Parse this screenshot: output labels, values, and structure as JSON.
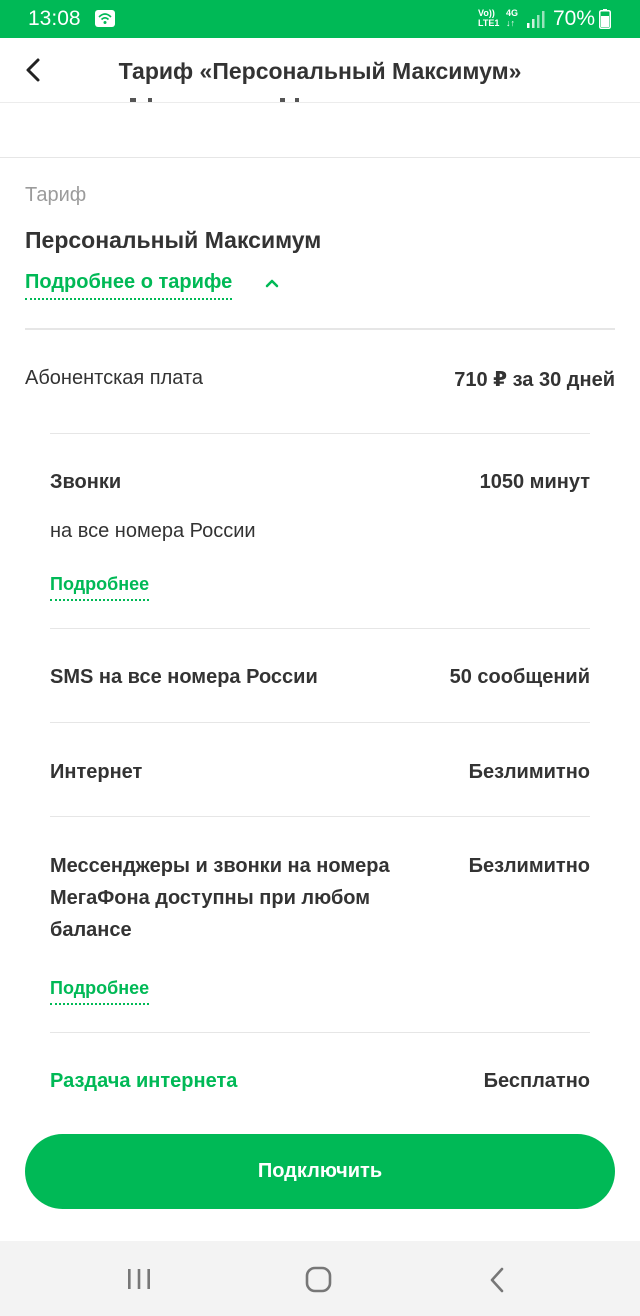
{
  "status_bar": {
    "time": "13:08",
    "network_top": "Vo))",
    "network_bottom": "LTE1",
    "network_type": "4G",
    "battery_percent": "70%"
  },
  "header": {
    "title": "Тариф «Персональный Максимум»"
  },
  "tariff": {
    "caption": "Тариф",
    "name": "Персональный Максимум",
    "details_link": "Подробнее о тарифе"
  },
  "fee": {
    "label": "Абонентская плата",
    "value": "710 ₽ за 30 дней"
  },
  "rows": {
    "calls": {
      "label": "Звонки",
      "value": "1050 минут",
      "subtitle": "на все номера России",
      "more": "Подробнее"
    },
    "sms": {
      "label": "SMS на все номера России",
      "value": "50 сообщений"
    },
    "internet": {
      "label": "Интернет",
      "value": "Безлимитно"
    },
    "messengers": {
      "label": "Мессенджеры и звонки на номера МегаФона доступны при любом балансе",
      "value": "Безлимитно",
      "more": "Подробнее"
    },
    "sharing": {
      "label": "Раздача интернета",
      "value": "Бесплатно"
    }
  },
  "connect_button": "Подключить",
  "colors": {
    "brand_green": "#00b956",
    "text": "#333333",
    "muted": "#9b9b9b"
  },
  "icons": {
    "back": "chevron-left-icon",
    "expand": "chevron-up-icon",
    "nav_recent": "recent-apps-icon",
    "nav_home": "home-icon",
    "nav_back": "nav-back-icon"
  }
}
